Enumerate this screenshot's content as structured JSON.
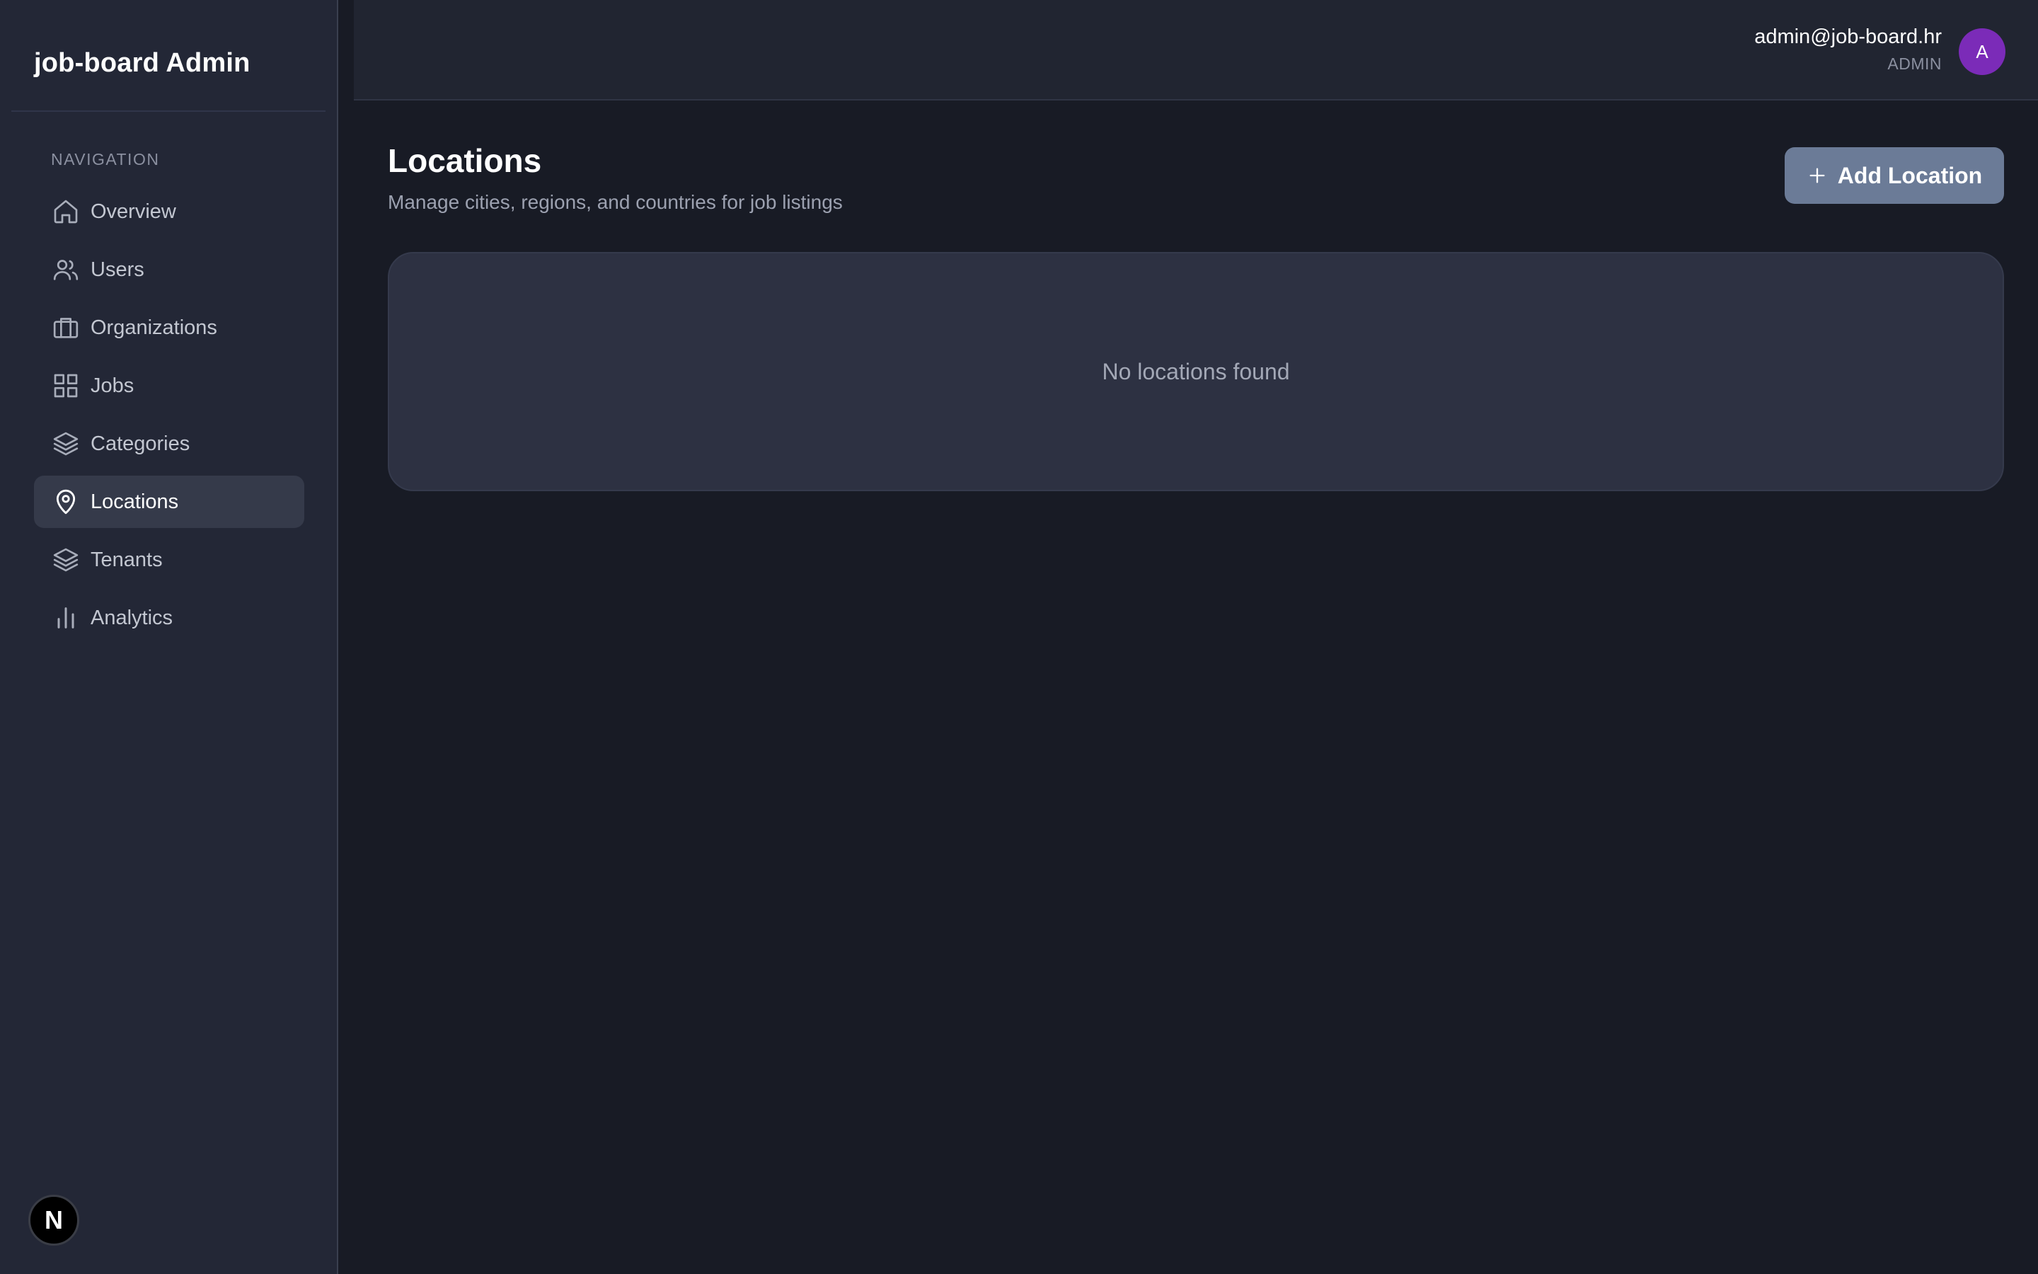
{
  "sidebar": {
    "brand": "job-board Admin",
    "nav_heading": "NAVIGATION",
    "items": [
      {
        "label": "Overview",
        "icon": "home-icon"
      },
      {
        "label": "Users",
        "icon": "users-icon"
      },
      {
        "label": "Organizations",
        "icon": "briefcase-icon"
      },
      {
        "label": "Jobs",
        "icon": "grid-icon"
      },
      {
        "label": "Categories",
        "icon": "layers-icon"
      },
      {
        "label": "Locations",
        "icon": "map-pin-icon",
        "active": true
      },
      {
        "label": "Tenants",
        "icon": "layers-icon"
      },
      {
        "label": "Analytics",
        "icon": "bar-chart-icon"
      }
    ],
    "footer_badge": "N"
  },
  "header": {
    "user_email": "admin@job-board.hr",
    "user_role": "ADMIN",
    "avatar_initial": "A"
  },
  "main": {
    "title": "Locations",
    "subtitle": "Manage cities, regions, and countries for job listings",
    "add_button_label": "Add Location",
    "empty_message": "No locations found"
  },
  "colors": {
    "background": "#181b25",
    "sidebar": "#232736",
    "header": "#212531",
    "active_nav": "#353a4a",
    "button": "#6b7b97",
    "card": "#2d3142",
    "avatar": "#7b2bb8"
  }
}
